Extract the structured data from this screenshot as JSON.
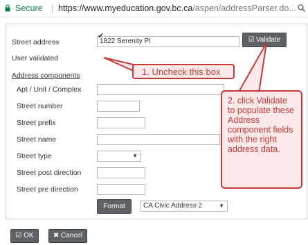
{
  "browser": {
    "secure_label": "Secure",
    "separator": "|",
    "url_host": "https://www.myeducation.gov.bc.ca",
    "url_path": "/aspen/addressParser.do..."
  },
  "form": {
    "street_address": {
      "label": "Street address",
      "value": "1822 Serenity Pl"
    },
    "validate_button": "Validate",
    "user_validated": {
      "label": "User validated",
      "checked": true
    },
    "section_heading": "Address components",
    "fields": [
      {
        "label": "Apt / Unit / Complex",
        "value": ""
      },
      {
        "label": "Street number",
        "value": ""
      },
      {
        "label": "Street prefix",
        "value": ""
      },
      {
        "label": "Street name",
        "value": ""
      },
      {
        "label": "Street type",
        "value": ""
      },
      {
        "label": "Street post direction",
        "value": ""
      },
      {
        "label": "Street pre direction",
        "value": ""
      }
    ],
    "format_button": "Format",
    "format_select": "CA Civic Address 2"
  },
  "callouts": {
    "one": "1. Uncheck this box",
    "two": "2. click Validate to populate these Address component fields with the right address data."
  },
  "footer": {
    "ok": "OK",
    "cancel": "Cancel"
  },
  "colors": {
    "callout_red": "#c43a3a",
    "callout_fill": "#fce8e8",
    "button_gray": "#5e6166",
    "secure_green": "#0b8043"
  }
}
